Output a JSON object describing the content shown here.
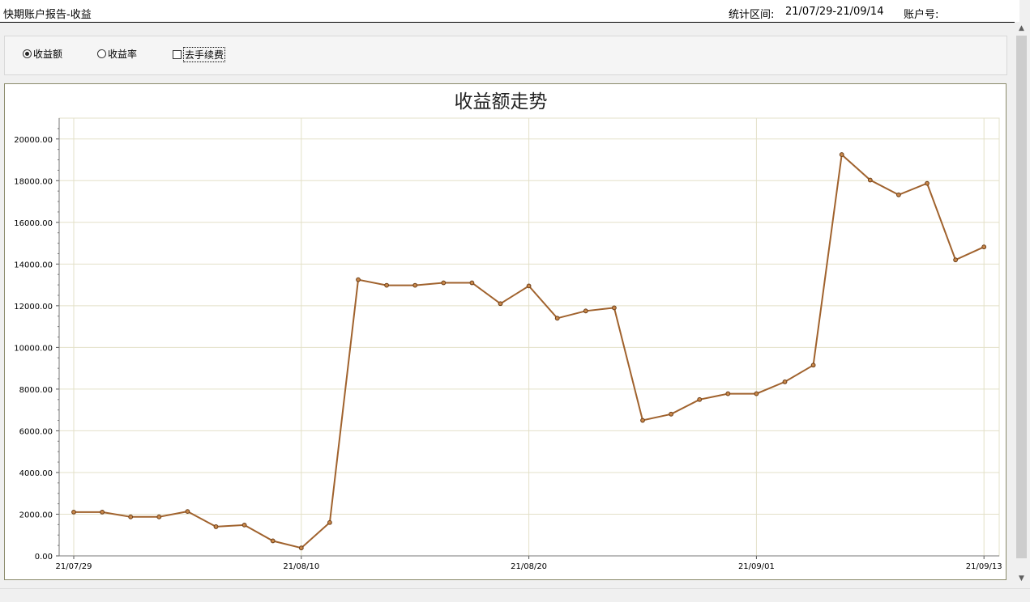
{
  "header": {
    "title": "快期账户报告-收益",
    "period_label": "统计区间:",
    "period_value": "21/07/29-21/09/14",
    "account_label": "账户号:"
  },
  "options": {
    "radio_amount": "收益额",
    "radio_rate": "收益率",
    "checkbox_fee": "去手续费",
    "selected": "收益额"
  },
  "colors": {
    "line": "#a0622d",
    "grid": "#e3e0c8",
    "axis": "#8a8a6a"
  },
  "chart_data": {
    "type": "line",
    "title": "收益额走势",
    "xlabel": "",
    "ylabel": "",
    "grid": true,
    "ylim": [
      0,
      21000
    ],
    "y_ticks": [
      "0.00",
      "2000.00",
      "4000.00",
      "6000.00",
      "8000.00",
      "10000.00",
      "12000.00",
      "14000.00",
      "16000.00",
      "18000.00",
      "20000.00"
    ],
    "x_ticks": [
      "21/07/29",
      "21/08/10",
      "21/08/20",
      "21/09/01",
      "21/09/13"
    ],
    "x_tick_index": [
      0,
      8,
      16,
      24,
      32
    ],
    "values": [
      2100,
      2100,
      1870,
      1870,
      2130,
      1400,
      1480,
      720,
      380,
      1600,
      13250,
      12980,
      12980,
      13100,
      13100,
      12100,
      12950,
      11400,
      11750,
      11900,
      6500,
      6800,
      7500,
      7780,
      7780,
      8350,
      9150,
      19250,
      18030,
      17320,
      17870,
      14200,
      14820
    ]
  }
}
